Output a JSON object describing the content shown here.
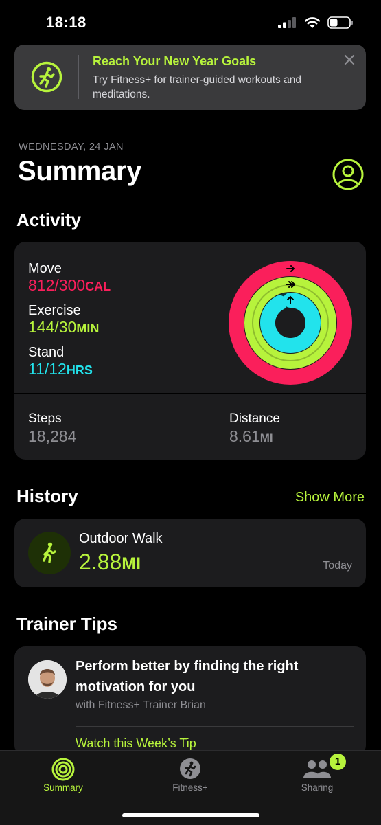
{
  "status_bar": {
    "time": "18:18"
  },
  "banner": {
    "title": "Reach Your New Year Goals",
    "text": "Try Fitness+ for trainer-guided workouts and meditations."
  },
  "header": {
    "date": "WEDNESDAY, 24 JAN",
    "title": "Summary"
  },
  "activity": {
    "section_title": "Activity",
    "move": {
      "label": "Move",
      "value": "812/300",
      "unit": "CAL",
      "progress": 2.71
    },
    "exercise": {
      "label": "Exercise",
      "value": "144/30",
      "unit": "MIN",
      "progress": 4.8
    },
    "stand": {
      "label": "Stand",
      "value": "11/12",
      "unit": "HRS",
      "progress": 0.92
    },
    "steps": {
      "label": "Steps",
      "value": "18,284"
    },
    "distance": {
      "label": "Distance",
      "value": "8.61",
      "unit": "MI"
    }
  },
  "history": {
    "section_title": "History",
    "show_more": "Show More",
    "item": {
      "name": "Outdoor Walk",
      "value": "2.88",
      "unit": "MI",
      "when": "Today"
    }
  },
  "trainer_tips": {
    "section_title": "Trainer Tips",
    "title": "Perform better by finding the right motivation for you",
    "subtitle": "with Fitness+ Trainer Brian",
    "link": "Watch this Week’s Tip"
  },
  "tabs": [
    {
      "label": "Summary",
      "icon": "activity-rings-icon",
      "active": true
    },
    {
      "label": "Fitness+",
      "icon": "fitness-plus-icon",
      "active": false
    },
    {
      "label": "Sharing",
      "icon": "sharing-icon",
      "active": false,
      "badge": "1"
    }
  ],
  "colors": {
    "accent": "#b7f33c",
    "move": "#fa1f5b",
    "exercise": "#b7f33c",
    "stand": "#22e3ec",
    "card": "#1c1c1e",
    "banner": "#3a3a3c"
  }
}
